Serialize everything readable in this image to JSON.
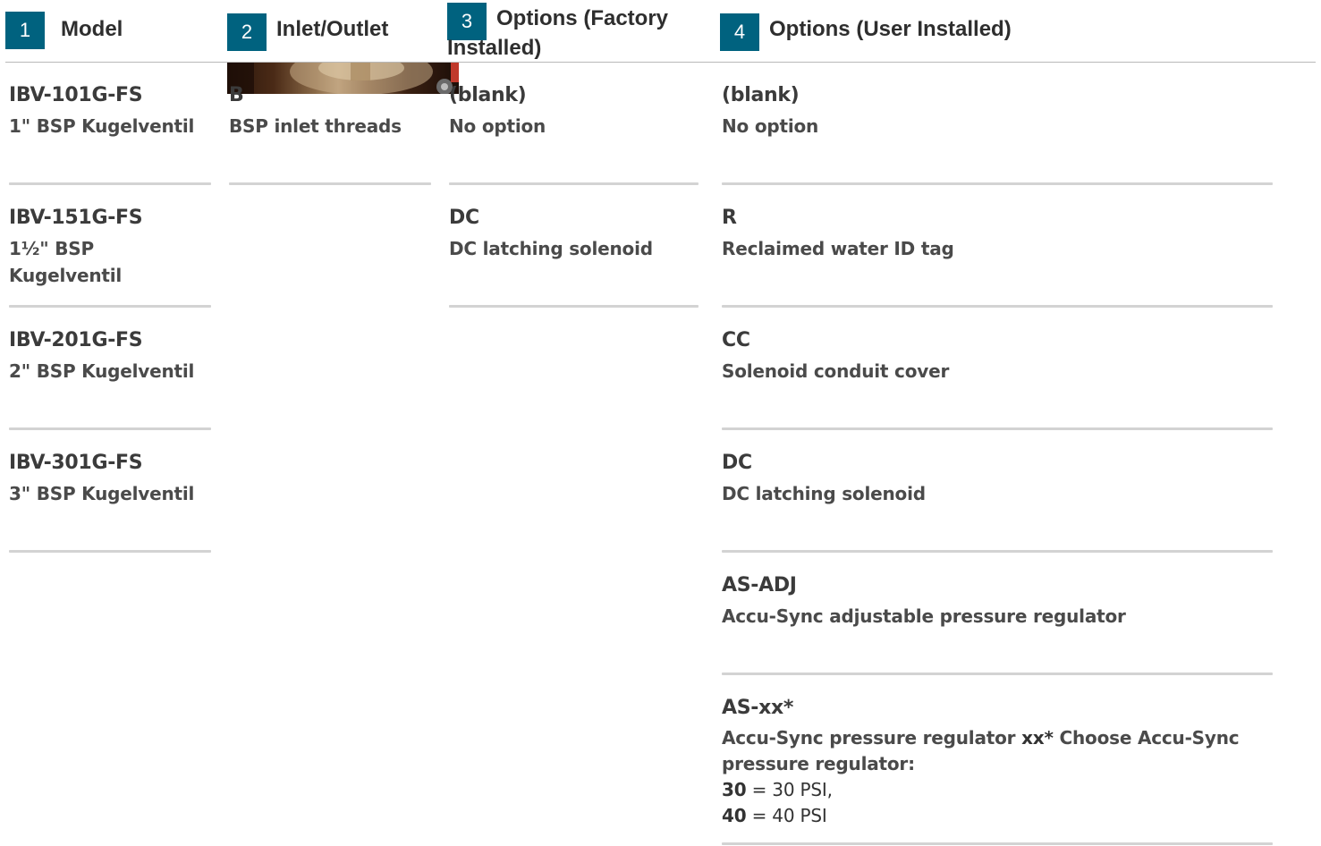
{
  "headers": [
    {
      "number": "1",
      "title": "Model"
    },
    {
      "number": "2",
      "title": "Inlet/Outlet"
    },
    {
      "number": "3",
      "title_line1": "Options (Factory",
      "title_line2": "Installed)"
    },
    {
      "number": "4",
      "title": "Options (User Installed)"
    }
  ],
  "columns": {
    "model": [
      {
        "code": "IBV-101G-FS",
        "desc": "1\" BSP Kugelventil"
      },
      {
        "code": "IBV-151G-FS",
        "desc_line1": "1½\" BSP",
        "desc_line2": "Kugelventil"
      },
      {
        "code": "IBV-201G-FS",
        "desc": "2\" BSP Kugelventil"
      },
      {
        "code": "IBV-301G-FS",
        "desc": "3\" BSP Kugelventil"
      }
    ],
    "inlet": [
      {
        "code": "B",
        "desc": "BSP inlet threads"
      }
    ],
    "factory": [
      {
        "code": "(blank)",
        "desc": "No option"
      },
      {
        "code": "DC",
        "desc": "DC latching solenoid"
      }
    ],
    "user": [
      {
        "code": "(blank)",
        "desc": "No option"
      },
      {
        "code": "R",
        "desc": "Reclaimed water ID tag"
      },
      {
        "code": "CC",
        "desc": "Solenoid conduit cover"
      },
      {
        "code": "DC",
        "desc": "DC latching solenoid"
      },
      {
        "code": "AS-ADJ",
        "desc": "Accu-Sync adjustable pressure regulator"
      },
      {
        "code": "AS-xx*",
        "desc_prefix": "Accu-Sync pressure regulator ",
        "desc_bold": "xx*",
        "desc_suffix_line1": " Choose Accu-Sync",
        "desc_line2": "pressure regulator:",
        "opt1_value": "30",
        "opt1_text": " = 30 PSI,",
        "opt2_value": "40",
        "opt2_text": " = 40 PSI"
      }
    ]
  },
  "photo": {
    "alt": "valve-photo"
  },
  "colors": {
    "badge": "#00627f",
    "separator": "#d3d3d3",
    "header_line": "#b8b8b8"
  }
}
